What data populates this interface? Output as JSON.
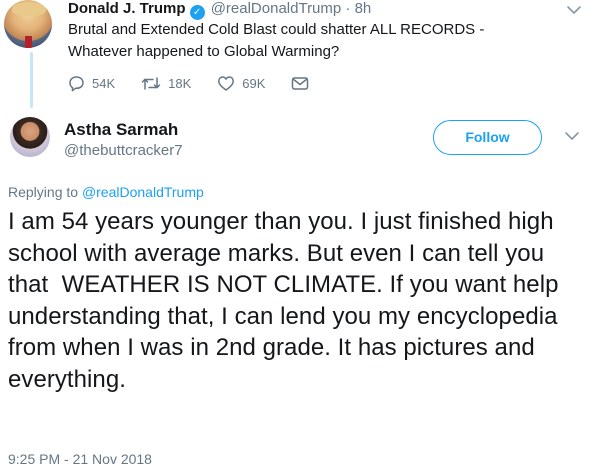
{
  "parent_tweet": {
    "name": "Donald J. Trump",
    "handle": "@realDonaldTrump",
    "separator": "·",
    "time": "8h",
    "text": "Brutal and Extended Cold Blast could shatter ALL RECORDS - Whatever happened to Global Warming?",
    "actions": {
      "replies": "54K",
      "retweets": "18K",
      "likes": "69K"
    },
    "icons": [
      "verified-badge-icon",
      "reply-icon",
      "retweet-icon",
      "like-icon",
      "message-icon",
      "chevron-down-icon"
    ]
  },
  "reply_tweet": {
    "name": "Astha Sarmah",
    "handle": "@thebuttcracker7",
    "follow_label": "Follow",
    "replying_prefix": "Replying to",
    "replying_to": "@realDonaldTrump",
    "text": "I am 54 years younger than you. I just finished high school with average marks. But even I can tell you that  WEATHER IS NOT CLIMATE. If you want help understanding that, I can lend you my encyclopedia from when I was in 2nd grade. It has pictures and everything.",
    "timestamp": "9:25 PM - 21 Nov 2018"
  },
  "colors": {
    "accent": "#1da1f2",
    "secondary_text": "#657786",
    "primary_text": "#14171a",
    "thread_line": "#c4e6f8"
  }
}
